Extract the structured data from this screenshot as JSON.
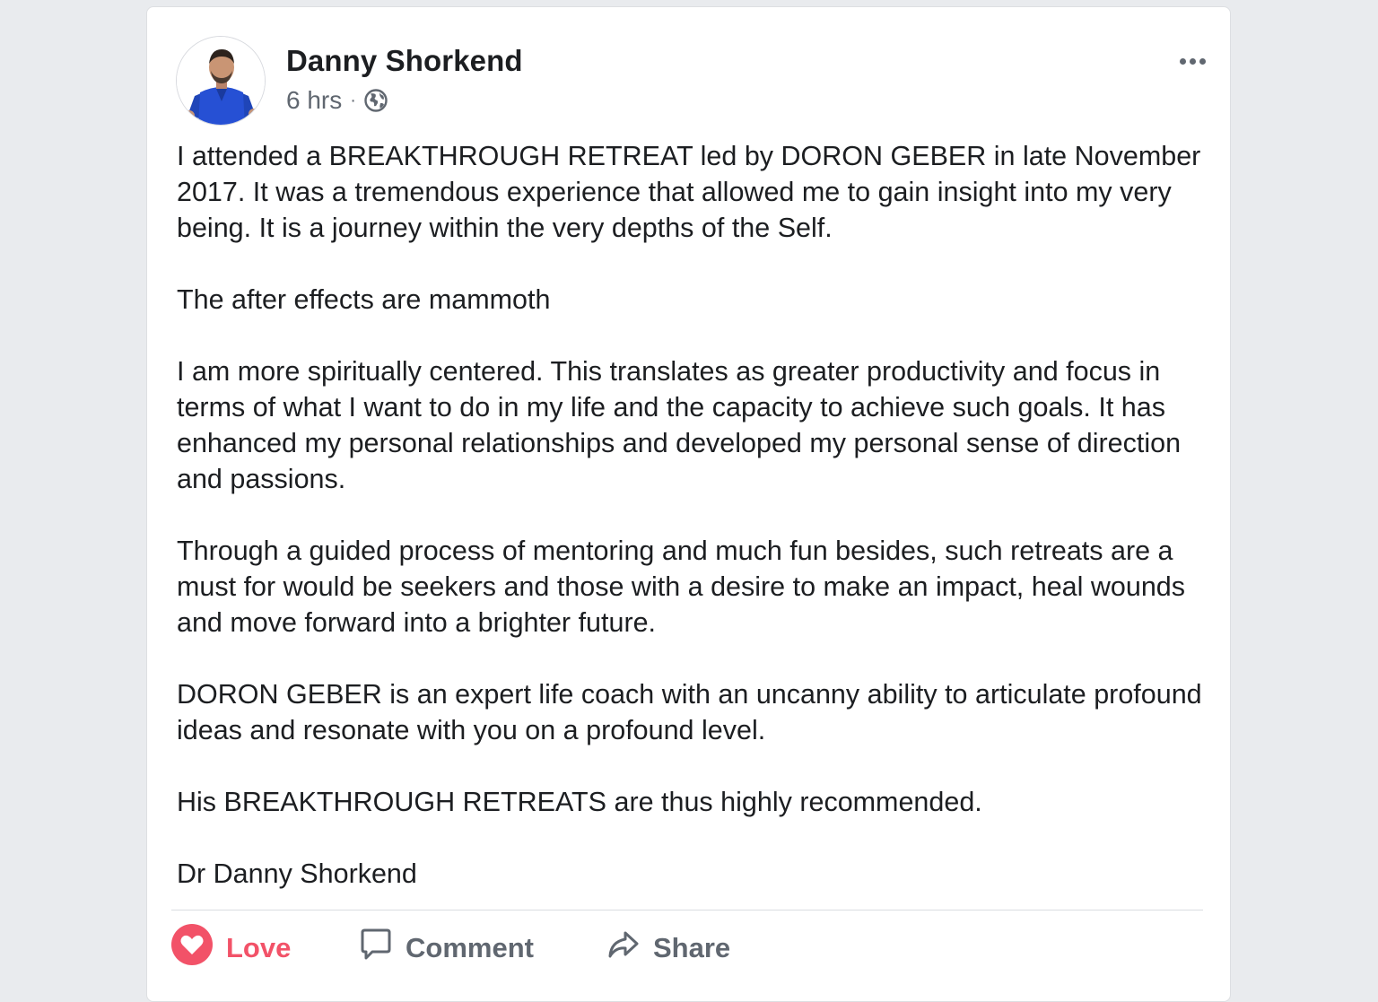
{
  "post": {
    "author": "Danny Shorkend",
    "time": "6 hrs",
    "separator": "·",
    "privacy_icon": "globe-icon",
    "paragraphs": [
      "I attended a BREAKTHROUGH RETREAT led by DORON GEBER in late November 2017. It was a tremendous experience that allowed me to gain insight into my very being. It is a journey within the very depths of the Self.",
      "The after effects are mammoth",
      "I am more spiritually centered. This translates as greater productivity and focus in terms of what I want to do in my life and the capacity to achieve such goals. It has enhanced my personal relationships and developed my personal sense of direction and passions.",
      "Through a guided process of mentoring and much fun besides, such retreats are a must for would be seekers and those with a desire to make an impact, heal wounds and move forward into a brighter future.",
      "DORON GEBER is an expert life coach with an uncanny ability to articulate profound ideas and resonate with you on a profound level.",
      "His BREAKTHROUGH RETREATS are thus highly recommended.",
      "Dr Danny Shorkend"
    ]
  },
  "actions": {
    "love_label": "Love",
    "comment_label": "Comment",
    "share_label": "Share"
  },
  "colors": {
    "page_background": "#e9ebee",
    "card_background": "#ffffff",
    "text": "#1c1e21",
    "secondary_text": "#606770",
    "love_accent": "#f25268",
    "divider": "#dadde1"
  }
}
